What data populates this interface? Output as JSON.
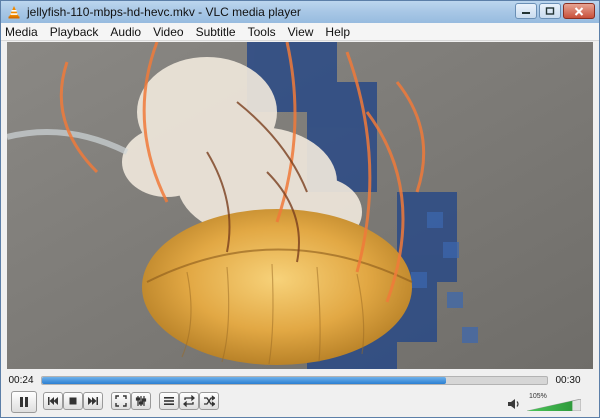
{
  "window": {
    "title": "jellyfish-110-mbps-hd-hevc.mkv - VLC media player"
  },
  "menu": [
    "Media",
    "Playback",
    "Audio",
    "Video",
    "Subtitle",
    "Tools",
    "View",
    "Help"
  ],
  "playback": {
    "elapsed": "00:24",
    "total": "00:30",
    "progress": 0.8
  },
  "volume": {
    "label": "105%",
    "level": 1.05
  },
  "icons": {
    "app": "vlc-cone-icon",
    "minimize": "minimize-icon",
    "maximize": "maximize-icon",
    "close": "close-icon",
    "pause": "pause-icon",
    "previous": "previous-icon",
    "stop": "stop-icon",
    "next": "next-icon",
    "fullscreen": "fullscreen-icon",
    "extended": "extended-settings-icon",
    "playlist": "playlist-icon",
    "loop": "loop-icon",
    "shuffle": "shuffle-icon",
    "volume": "speaker-icon"
  },
  "colors": {
    "progress": "#2b7fd2",
    "volume": "#3fb34f"
  }
}
